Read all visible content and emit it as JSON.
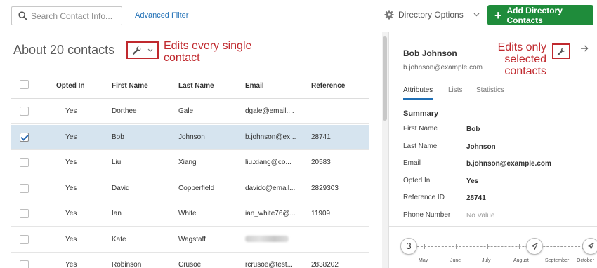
{
  "toolbar": {
    "search_placeholder": "Search Contact Info...",
    "advanced_filter": "Advanced Filter",
    "directory_options": "Directory Options",
    "add_contacts": "Add Directory Contacts"
  },
  "list": {
    "title": "About 20 contacts",
    "annotation": "Edits every single contact",
    "columns": [
      "Opted In",
      "First Name",
      "Last Name",
      "Email",
      "Reference"
    ],
    "rows": [
      {
        "opted_in": "Yes",
        "first": "Dorthee",
        "last": "Gale",
        "email": "dgale@email....",
        "reference": "",
        "checked": false,
        "email_blurred": false
      },
      {
        "opted_in": "Yes",
        "first": "Bob",
        "last": "Johnson",
        "email": "b.johnson@ex...",
        "reference": "28741",
        "checked": true,
        "email_blurred": false
      },
      {
        "opted_in": "Yes",
        "first": "Liu",
        "last": "Xiang",
        "email": "liu.xiang@co...",
        "reference": "20583",
        "checked": false,
        "email_blurred": false
      },
      {
        "opted_in": "Yes",
        "first": "David",
        "last": "Copperfield",
        "email": "davidc@email...",
        "reference": "2829303",
        "checked": false,
        "email_blurred": false
      },
      {
        "opted_in": "Yes",
        "first": "Ian",
        "last": "White",
        "email": "ian_white76@...",
        "reference": "11909",
        "checked": false,
        "email_blurred": false
      },
      {
        "opted_in": "Yes",
        "first": "Kate",
        "last": "Wagstaff",
        "email": "",
        "reference": "",
        "checked": false,
        "email_blurred": true
      },
      {
        "opted_in": "Yes",
        "first": "Robinson",
        "last": "Crusoe",
        "email": "rcrusoe@test...",
        "reference": "2838202",
        "checked": false,
        "email_blurred": false
      }
    ]
  },
  "detail": {
    "name": "Bob Johnson",
    "email": "b.johnson@example.com",
    "annotation": "Edits only selected contacts",
    "tabs": [
      "Attributes",
      "Lists",
      "Statistics"
    ],
    "summary_title": "Summary",
    "fields": [
      {
        "label": "First Name",
        "value": "Bob",
        "muted": false
      },
      {
        "label": "Last Name",
        "value": "Johnson",
        "muted": false
      },
      {
        "label": "Email",
        "value": "b.johnson@example.com",
        "muted": false
      },
      {
        "label": "Opted In",
        "value": "Yes",
        "muted": false
      },
      {
        "label": "Reference ID",
        "value": "28741",
        "muted": false
      },
      {
        "label": "Phone Number",
        "value": "No Value",
        "muted": true
      }
    ],
    "timeline": {
      "count": "3",
      "months": [
        "May",
        "June",
        "July",
        "August",
        "September",
        "October"
      ]
    }
  },
  "colors": {
    "accent_blue": "#1f6fb5",
    "brand_green": "#1f8c3b",
    "annotation_red": "#c0292e",
    "selected_row": "#d6e4ef"
  }
}
